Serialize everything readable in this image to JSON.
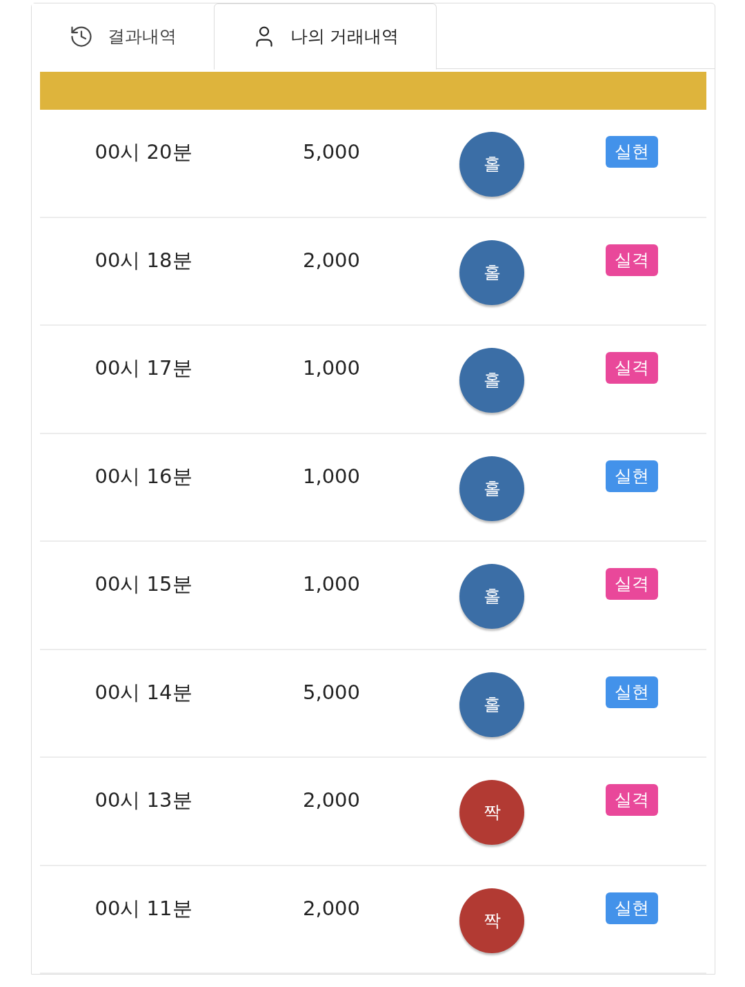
{
  "tabs": [
    {
      "label": "결과내역",
      "selected": false
    },
    {
      "label": "나의 거래내역",
      "selected": true
    }
  ],
  "rows": [
    {
      "time": "00시 20분",
      "amount": "5,000",
      "pick": {
        "label": "홀",
        "color": "#3b6ea6"
      },
      "result": {
        "label": "실현",
        "color": "#4392ea"
      }
    },
    {
      "time": "00시 18분",
      "amount": "2,000",
      "pick": {
        "label": "홀",
        "color": "#3b6ea6"
      },
      "result": {
        "label": "실격",
        "color": "#e9489a"
      }
    },
    {
      "time": "00시 17분",
      "amount": "1,000",
      "pick": {
        "label": "홀",
        "color": "#3b6ea6"
      },
      "result": {
        "label": "실격",
        "color": "#e9489a"
      }
    },
    {
      "time": "00시 16분",
      "amount": "1,000",
      "pick": {
        "label": "홀",
        "color": "#3b6ea6"
      },
      "result": {
        "label": "실현",
        "color": "#4392ea"
      }
    },
    {
      "time": "00시 15분",
      "amount": "1,000",
      "pick": {
        "label": "홀",
        "color": "#3b6ea6"
      },
      "result": {
        "label": "실격",
        "color": "#e9489a"
      }
    },
    {
      "time": "00시 14분",
      "amount": "5,000",
      "pick": {
        "label": "홀",
        "color": "#3b6ea6"
      },
      "result": {
        "label": "실현",
        "color": "#4392ea"
      }
    },
    {
      "time": "00시 13분",
      "amount": "2,000",
      "pick": {
        "label": "짝",
        "color": "#b23a33"
      },
      "result": {
        "label": "실격",
        "color": "#e9489a"
      }
    },
    {
      "time": "00시 11분",
      "amount": "2,000",
      "pick": {
        "label": "짝",
        "color": "#b23a33"
      },
      "result": {
        "label": "실현",
        "color": "#4392ea"
      }
    }
  ]
}
